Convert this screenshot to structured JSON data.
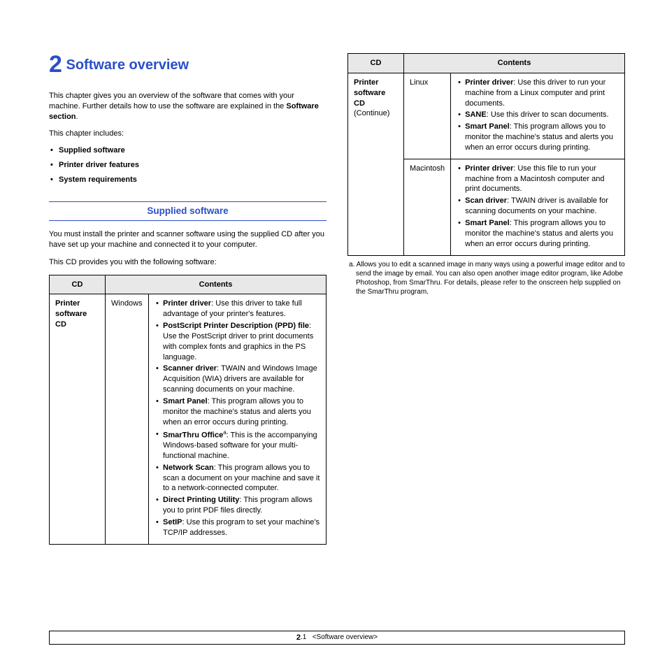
{
  "chapter": {
    "number": "2",
    "title": "Software overview"
  },
  "intro1": "This chapter gives you an overview of the software that comes with your machine. Further details how to use the software are explained in the ",
  "intro1b": "Software section",
  "intro1c": ".",
  "includes_label": "This chapter includes:",
  "toc": [
    "Supplied software",
    "Printer driver features",
    "System requirements"
  ],
  "section1": {
    "heading": "Supplied software",
    "p1": "You must install the printer and scanner software using the supplied CD after you have set up your machine and connected it to your computer.",
    "p2": "This CD provides you with the following software:"
  },
  "table1": {
    "headers": [
      "CD",
      "Contents"
    ],
    "cdname": "Printer software CD",
    "os": "Windows",
    "items": [
      {
        "b": "Printer driver",
        "t": ": Use this driver to take full advantage of your printer's features."
      },
      {
        "b": "PostScript Printer Description (PPD) file",
        "t": ": Use the PostScript driver to print documents with complex fonts and graphics in the PS language."
      },
      {
        "b": "Scanner driver",
        "t": ": TWAIN and Windows Image Acquisition (WIA) drivers are available for scanning documents on your machine."
      },
      {
        "b": "Smart Panel",
        "t": ": This program allows you to monitor the machine's status and alerts you when an error occurs during printing."
      },
      {
        "b": "SmarThru Office",
        "sup": "a",
        "t": ": This is the accompanying Windows-based software for your multi-functional machine."
      },
      {
        "b": "Network Scan",
        "t": ": This program allows you to scan a document on your machine and save it to a network-connected computer."
      },
      {
        "b": "Direct Printing Utility",
        "t": ": This program allows you to print PDF files directly."
      },
      {
        "b": "SetIP",
        "t": ": Use this program to set your machine's TCP/IP addresses."
      }
    ]
  },
  "table2": {
    "headers": [
      "CD",
      "Contents"
    ],
    "cdname": "Printer software CD",
    "continue": "(Continue)",
    "rows": [
      {
        "os": "Linux",
        "items": [
          {
            "b": "Printer driver",
            "t": ": Use this driver to run your machine from a Linux computer and print documents."
          },
          {
            "b": "SANE",
            "t": ": Use this driver to scan documents."
          },
          {
            "b": "Smart Panel",
            "t": ": This program allows you to monitor the machine's status and alerts you when an error occurs during printing."
          }
        ]
      },
      {
        "os": "Macintosh",
        "items": [
          {
            "b": "Printer driver",
            "t": ": Use this file to run your machine from a Macintosh computer and print documents."
          },
          {
            "b": "Scan driver",
            "t": ": TWAIN driver is available for scanning documents on your machine."
          },
          {
            "b": "Smart Panel",
            "t": ": This program allows you to monitor the machine's status and alerts you when an error occurs during printing."
          }
        ]
      }
    ]
  },
  "footnote": {
    "marker": "a.",
    "text": "Allows you to edit a scanned image in many ways using a powerful image editor and to send the image by email. You can also open another image editor program, like Adobe Photoshop, from SmarThru. For details, please refer to the onscreen help supplied on the SmarThru program."
  },
  "footer": {
    "page_chapter": "2",
    "page_num": ".1",
    "crumb": "<Software overview>"
  }
}
